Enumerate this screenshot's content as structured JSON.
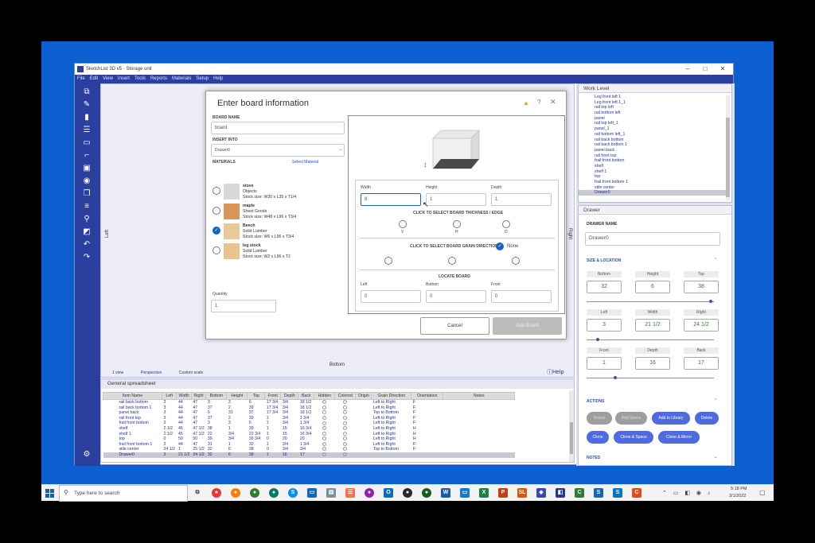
{
  "window": {
    "title": "SketchList 3D v5 - Storage unit"
  },
  "menu": [
    "File",
    "Edit",
    "View",
    "Insert",
    "Tools",
    "Reports",
    "Materials",
    "Setup",
    "Help"
  ],
  "canvas": {
    "left": "Left",
    "right": "Right",
    "bottom": "Bottom",
    "view": "1 view",
    "perspective": "Perspective",
    "custom_scale": "Custom scale",
    "help": "Help"
  },
  "dialog": {
    "title": "Enter board information",
    "board_name_label": "BOARD NAME",
    "board_name": "board",
    "insert_into_label": "INSERT INTO",
    "insert_into": "Drawer0",
    "materials_label": "MATERIALS",
    "select_material": "Select Material",
    "materials": [
      {
        "name": "stove",
        "type": "Objects",
        "stock": "Stock size: W30 x L35 x T1/4",
        "color": "#d8d8d8",
        "selected": false
      },
      {
        "name": "maple",
        "type": "Sheet Goods",
        "stock": "Stock size: W48 x L96 x T3/4",
        "color": "#d9955a",
        "selected": false
      },
      {
        "name": "Beech",
        "type": "Solid Lumber",
        "stock": "Stock size: W6 x L96 x T3/4",
        "color": "#e8c99a",
        "selected": true
      },
      {
        "name": "leg stock",
        "type": "Solid Lumber",
        "stock": "Stock size: W2 x L96 x T2",
        "color": "#e7c58d",
        "selected": false
      }
    ],
    "quantity_label": "Quantity",
    "quantity": "1",
    "width_label": "Width",
    "width": "8",
    "height_label": "Height",
    "height": "1",
    "depth_label": "Depth",
    "depth": "1",
    "thickness_label": "CLICK TO SELECT BOARD THICKNESS / EDGE",
    "thickness_options": [
      "V",
      "H",
      "D"
    ],
    "grain_label": "CLICK TO SELECT BOARD GRAIN DIRECTION",
    "grain_none": "None",
    "locate_label": "LOCATE BOARD",
    "left_label": "Left",
    "left": "0",
    "bottom_label": "Bottom",
    "bottom": "0",
    "front_label": "Front",
    "front": "0",
    "cancel": "Cancel",
    "add": "Add Board"
  },
  "spreadsheet": {
    "title": "General spreadsheet",
    "columns": [
      "Item Name",
      "Left",
      "Width",
      "Right",
      "Bottom",
      "Height",
      "Top",
      "Front",
      "Depth",
      "Back",
      "Hidden",
      "Colored",
      "Origin",
      "Grain Direction",
      "Orientation",
      "Notes"
    ],
    "rows": [
      [
        "rail back bottom",
        "3",
        "44",
        "47",
        "3",
        "3",
        "6",
        "17 3/4",
        "3/4",
        "18 1/2",
        "",
        "",
        "",
        "Left to Right",
        "F",
        ""
      ],
      [
        "rail back bottom 1",
        "3",
        "44",
        "47",
        "37",
        "2",
        "39",
        "17 3/4",
        "3/4",
        "18 1/2",
        "",
        "",
        "",
        "Left to Right",
        "F",
        ""
      ],
      [
        "panel back",
        "3",
        "44",
        "47",
        "6",
        "31",
        "37",
        "17 3/4",
        "3/4",
        "18 1/2",
        "",
        "",
        "",
        "Top to Bottom",
        "F",
        ""
      ],
      [
        "rail front top",
        "3",
        "44",
        "47",
        "37",
        "2",
        "39",
        "1",
        "3/4",
        "1 3/4",
        "",
        "",
        "",
        "Left to Right",
        "F",
        ""
      ],
      [
        "frail front bottom",
        "3",
        "44",
        "47",
        "3",
        "3",
        "6",
        "1",
        "3/4",
        "1 3/4",
        "",
        "",
        "",
        "Left to Right",
        "F",
        ""
      ],
      [
        "shelf",
        "2 1/2",
        "45",
        "47 1/2",
        "38",
        "1",
        "39",
        "1",
        "15",
        "16 3/4",
        "",
        "",
        "",
        "Left to Right",
        "H",
        ""
      ],
      [
        "shelf 1",
        "2 1/2",
        "45",
        "47 1/2",
        "22",
        "3/4",
        "22 3/4",
        "1",
        "15",
        "16 3/4",
        "",
        "",
        "",
        "Left to Right",
        "H",
        ""
      ],
      [
        "top",
        "0",
        "50",
        "50",
        "39",
        "3/4",
        "39 3/4",
        "0",
        "20",
        "20",
        "",
        "",
        "",
        "Left to Right",
        "H",
        ""
      ],
      [
        "frail front bottom 1",
        "3",
        "44",
        "47",
        "31",
        "1",
        "32",
        "1",
        "3/4",
        "1 3/4",
        "",
        "",
        "",
        "Left to Right",
        "F",
        ""
      ],
      [
        "stile center",
        "24 1/2",
        "1",
        "25 1/2",
        "32",
        "6",
        "38",
        "0",
        "3/4",
        "3/4",
        "",
        "",
        "",
        "Top to Bottom",
        "F",
        ""
      ],
      [
        "Drawer0",
        "3",
        "21 1/2",
        "24 1/2",
        "32",
        "6",
        "38",
        "1",
        "16",
        "17",
        "",
        "",
        "",
        "",
        "",
        ""
      ]
    ]
  },
  "worklevel": {
    "title": "Work Level",
    "items": [
      "Leg front left 1",
      "Leg front left 1_1",
      "rail top left",
      "rail bottom left",
      "panel",
      "rail top left_1",
      "panel_1",
      "rail bottom left_1",
      "rail back bottom",
      "rail back bottom 1",
      "panel back",
      "rail front top",
      "frail front bottom",
      "shelf",
      "shelf 1",
      "top",
      "frail front bottom 1",
      "stile center",
      "Drawer0"
    ],
    "selected": "Drawer0"
  },
  "drawer": {
    "title": "Drawer",
    "name_label": "DRAWER NAME",
    "name": "Drawer0",
    "size_label": "SIZE & LOCATION",
    "bottom_label": "Bottom",
    "bottom": "32",
    "height_label": "Height",
    "height": "6",
    "top_label": "Top",
    "top": "38",
    "left_label": "Left",
    "left": "3",
    "width_label": "Width",
    "width": "21 1/2",
    "right_label": "Right",
    "right": "24 1/2",
    "front_label": "Front",
    "front": "1",
    "depth_label": "Depth",
    "depth": "16",
    "back_label": "Back",
    "back": "17",
    "actions_label": "ACTIONS",
    "actions": [
      "Resize",
      "Add Space",
      "Add to Library",
      "Delete",
      "Clone",
      "Clone & Space",
      "Clone & Mirror"
    ],
    "notes_label": "NOTES"
  },
  "taskbar": {
    "search": "Type here to search",
    "time": "5:18 PM",
    "date": "2/1/2022"
  }
}
